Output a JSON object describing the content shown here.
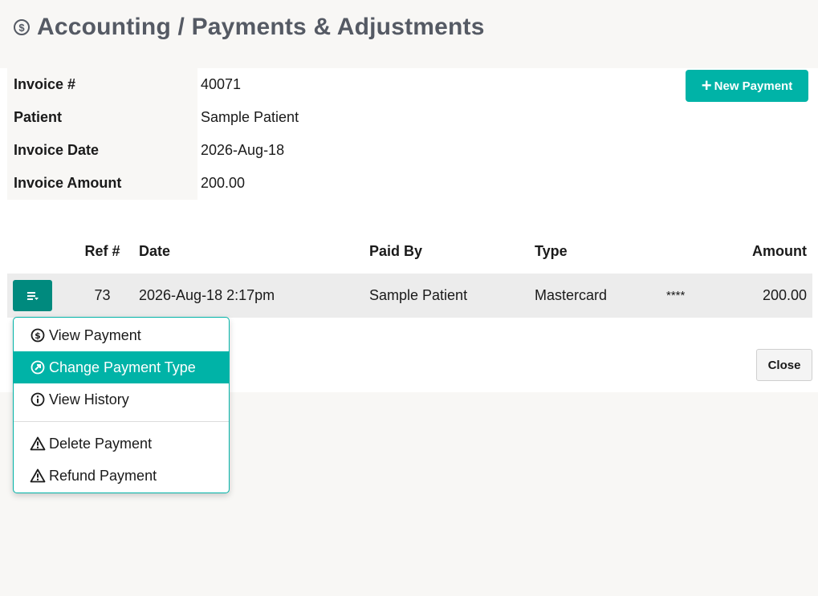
{
  "header": {
    "title": "Accounting / Payments & Adjustments",
    "icon": "dollar-circle-icon"
  },
  "invoice": [
    {
      "label": "Invoice #",
      "value": "40071"
    },
    {
      "label": "Patient",
      "value": "Sample Patient"
    },
    {
      "label": "Invoice Date",
      "value": "2026-Aug-18"
    },
    {
      "label": "Invoice Amount",
      "value": "200.00"
    }
  ],
  "new_payment_label": "New Payment",
  "table": {
    "headers": {
      "ref": "Ref #",
      "date": "Date",
      "paid_by": "Paid By",
      "type": "Type",
      "amount": "Amount"
    },
    "rows": [
      {
        "ref": "73",
        "date": "2026-Aug-18 2:17pm",
        "paid_by": "Sample Patient",
        "type": "Mastercard",
        "mask": "****",
        "amount": "200.00"
      }
    ]
  },
  "close_label": "Close",
  "menu": {
    "items": [
      {
        "label": "View Payment",
        "icon": "dollar-circle-icon"
      },
      {
        "label": "Change Payment Type",
        "icon": "arrow-up-right-circle-icon",
        "active": true
      },
      {
        "label": "View History",
        "icon": "info-circle-icon"
      },
      {
        "label": "Delete Payment",
        "icon": "warning-triangle-icon"
      },
      {
        "label": "Refund Payment",
        "icon": "warning-triangle-icon"
      }
    ]
  },
  "colors": {
    "accent": "#00b3a7",
    "accent_dark": "#008a7e",
    "title": "#555a64",
    "row_bg": "#ececec"
  }
}
